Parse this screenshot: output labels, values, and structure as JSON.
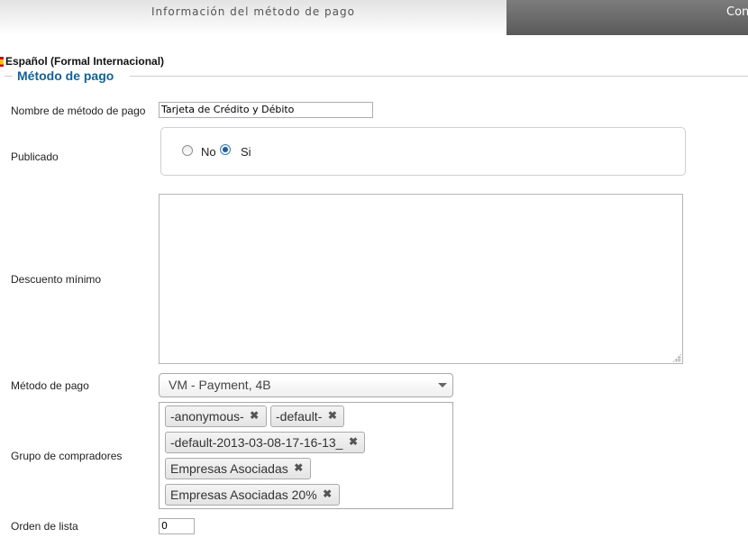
{
  "tabs": {
    "active_label": "Información del método de pago",
    "inactive_label": "Configuración"
  },
  "language": {
    "label": "Español (Formal Internacional)",
    "colors": [
      "#c60b1e",
      "#ffc400"
    ]
  },
  "fieldset": {
    "legend": "Método de pago",
    "legend_color": "#146295"
  },
  "fields": {
    "name": {
      "label": "Nombre de método de pago",
      "value": "Tarjeta de Crédito y Débito"
    },
    "published": {
      "label": "Publicado",
      "options": [
        "No",
        "Si"
      ],
      "selected": "Si"
    },
    "min_discount": {
      "label": "Descuento mínimo",
      "value": ""
    },
    "payment_method": {
      "label": "Método de pago",
      "selected": "VM - Payment, 4B"
    },
    "shopper_groups": {
      "label": "Grupo de compradores",
      "chips": [
        "-anonymous-",
        "-default-",
        "-default-2013-03-08-17-16-13_",
        "Empresas Asociadas",
        "Empresas Asociadas 20%"
      ]
    },
    "list_order": {
      "label": "Orden de lista",
      "value": "0"
    }
  }
}
